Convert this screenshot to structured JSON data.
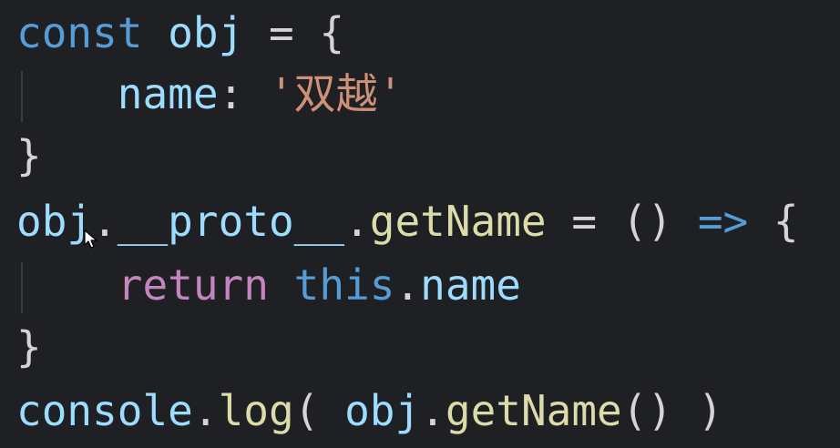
{
  "code": {
    "line1": {
      "kw": "const",
      "var": "obj",
      "op": "=",
      "brace": "{"
    },
    "line2": {
      "indent": "    ",
      "key": "name",
      "colon": ":",
      "str": "'双越'"
    },
    "line3": {
      "brace": "}"
    },
    "line4": {
      "obj": "obj",
      "dot1": ".",
      "proto": "__proto__",
      "dot2": ".",
      "method": "getName",
      "op": "=",
      "params": "()",
      "arrow": "=>",
      "brace": "{"
    },
    "line5": {
      "indent": "    ",
      "ret": "return",
      "this": "this",
      "dot": ".",
      "prop": "name"
    },
    "line6": {
      "brace": "}"
    },
    "line7": {
      "console": "console",
      "dot1": ".",
      "log": "log",
      "open": "(",
      "obj": "obj",
      "dot2": ".",
      "getName": "getName",
      "call": "()",
      "close": ")"
    }
  },
  "icons": {
    "cursor": "mouse-pointer-icon"
  },
  "colors": {
    "background": "#1f2023",
    "keyword": "#569cd6",
    "control": "#c586c0",
    "variable": "#9cdcfe",
    "function": "#dcdcaa",
    "string": "#ce9178"
  }
}
